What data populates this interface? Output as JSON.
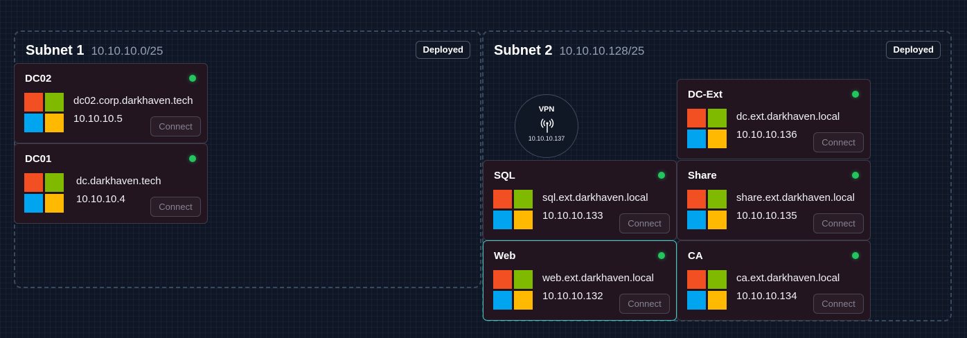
{
  "subnets": [
    {
      "name": "Subnet 1",
      "cidr": "10.10.10.0/25",
      "status": "Deployed",
      "machines": [
        {
          "name": "DC02",
          "host": "dc02.corp.darkhaven.tech",
          "ip": "10.10.10.5",
          "action": "Connect",
          "online": true,
          "os_icon": "windows-icon"
        },
        {
          "name": "DC01",
          "host": "dc.darkhaven.tech",
          "ip": "10.10.10.4",
          "action": "Connect",
          "online": true,
          "os_icon": "windows-icon"
        }
      ]
    },
    {
      "name": "Subnet 2",
      "cidr": "10.10.10.128/25",
      "status": "Deployed",
      "vpn": {
        "label": "VPN",
        "ip": "10.10.10.137",
        "icon": "antenna-icon"
      },
      "machines": [
        {
          "name": "DC-Ext",
          "host": "dc.ext.darkhaven.local",
          "ip": "10.10.10.136",
          "action": "Connect",
          "online": true,
          "os_icon": "windows-icon"
        },
        {
          "name": "SQL",
          "host": "sql.ext.darkhaven.local",
          "ip": "10.10.10.133",
          "action": "Connect",
          "online": true,
          "os_icon": "windows-icon"
        },
        {
          "name": "Share",
          "host": "share.ext.darkhaven.local",
          "ip": "10.10.10.135",
          "action": "Connect",
          "online": true,
          "os_icon": "windows-icon"
        },
        {
          "name": "Web",
          "host": "web.ext.darkhaven.local",
          "ip": "10.10.10.132",
          "action": "Connect",
          "online": true,
          "selected": true,
          "os_icon": "windows-icon"
        },
        {
          "name": "CA",
          "host": "ca.ext.darkhaven.local",
          "ip": "10.10.10.134",
          "action": "Connect",
          "online": true,
          "os_icon": "windows-icon"
        }
      ]
    }
  ],
  "colors": {
    "background": "#0f1727",
    "card": "#231520",
    "online": "#22c55e",
    "selected_border": "#3fc8c0",
    "windows_red": "#f25022",
    "windows_green": "#7fba00",
    "windows_blue": "#00a4ef",
    "windows_yellow": "#ffb900"
  }
}
